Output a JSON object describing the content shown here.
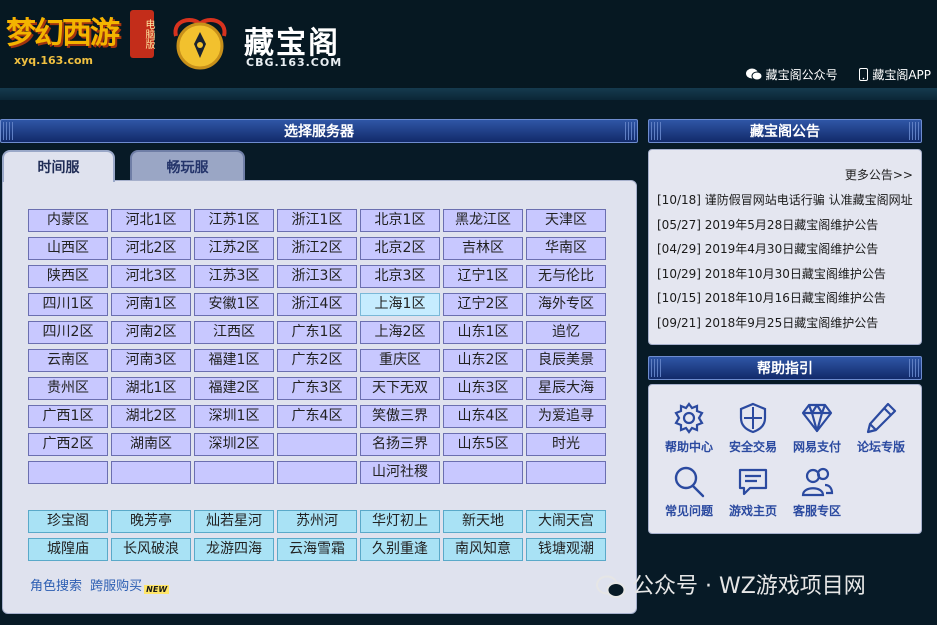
{
  "header": {
    "xy_logo_text": "梦幻西游",
    "xy_version": "电脑版",
    "xy_site": "xyq.163.com",
    "cbg_name": "藏宝阁",
    "cbg_site": "CBG.163.COM",
    "links": [
      "藏宝阁公众号",
      "藏宝阁APP"
    ]
  },
  "server_section": {
    "title": "选择服务器",
    "tabs": [
      {
        "label": "时间服",
        "active": true
      },
      {
        "label": "畅玩服",
        "active": false
      }
    ],
    "grid": [
      [
        "内蒙区",
        "河北1区",
        "江苏1区",
        "浙江1区",
        "北京1区",
        "黑龙江区",
        "天津区"
      ],
      [
        "山西区",
        "河北2区",
        "江苏2区",
        "浙江2区",
        "北京2区",
        "吉林区",
        "华南区"
      ],
      [
        "陕西区",
        "河北3区",
        "江苏3区",
        "浙江3区",
        "北京3区",
        "辽宁1区",
        "无与伦比"
      ],
      [
        "四川1区",
        "河南1区",
        "安徽1区",
        "浙江4区",
        "上海1区",
        "辽宁2区",
        "海外专区"
      ],
      [
        "四川2区",
        "河南2区",
        "江西区",
        "广东1区",
        "上海2区",
        "山东1区",
        "追忆"
      ],
      [
        "云南区",
        "河南3区",
        "福建1区",
        "广东2区",
        "重庆区",
        "山东2区",
        "良辰美景"
      ],
      [
        "贵州区",
        "湖北1区",
        "福建2区",
        "广东3区",
        "天下无双",
        "山东3区",
        "星辰大海"
      ],
      [
        "广西1区",
        "湖北2区",
        "深圳1区",
        "广东4区",
        "笑傲三界",
        "山东4区",
        "为爱追寻"
      ],
      [
        "广西2区",
        "湖南区",
        "深圳2区",
        "",
        "名扬三界",
        "山东5区",
        "时光"
      ],
      [
        "",
        "",
        "",
        "",
        "山河社稷",
        "",
        ""
      ]
    ],
    "highlighted": "上海1区",
    "special_grid": [
      [
        "珍宝阁",
        "晚芳亭",
        "灿若星河",
        "苏州河",
        "华灯初上",
        "新天地",
        "大闹天宫"
      ],
      [
        "城隍庙",
        "长风破浪",
        "龙游四海",
        "云海雪霜",
        "久别重逢",
        "南风知意",
        "钱塘观潮"
      ]
    ],
    "bottom_links": [
      "角色搜索",
      "跨服购买"
    ],
    "new_tag": "NEW"
  },
  "announcements": {
    "title": "藏宝阁公告",
    "more": "更多公告>>",
    "items": [
      "[10/18] 谨防假冒网站电话行骗 认准藏宝阁网址",
      "[05/27] 2019年5月28日藏宝阁维护公告",
      "[04/29] 2019年4月30日藏宝阁维护公告",
      "[10/29] 2018年10月30日藏宝阁维护公告",
      "[10/15] 2018年10月16日藏宝阁维护公告",
      "[09/21] 2018年9月25日藏宝阁维护公告"
    ]
  },
  "help": {
    "title": "帮助指引",
    "items": [
      {
        "label": "帮助中心",
        "icon": "gear-icon"
      },
      {
        "label": "安全交易",
        "icon": "shield-icon"
      },
      {
        "label": "网易支付",
        "icon": "diamond-icon"
      },
      {
        "label": "论坛专版",
        "icon": "pencil-icon"
      },
      {
        "label": "常见问题",
        "icon": "magnifier-icon"
      },
      {
        "label": "游戏主页",
        "icon": "chat-icon"
      },
      {
        "label": "客服专区",
        "icon": "users-icon"
      }
    ]
  },
  "watermark": "公众号 · WZ游戏项目网",
  "colors": {
    "server_btn": "#c8c8ff",
    "server_btn_highlight": "#c6ecff",
    "special_btn": "#a9e2f5",
    "title_bar": "#1f3e8a"
  }
}
